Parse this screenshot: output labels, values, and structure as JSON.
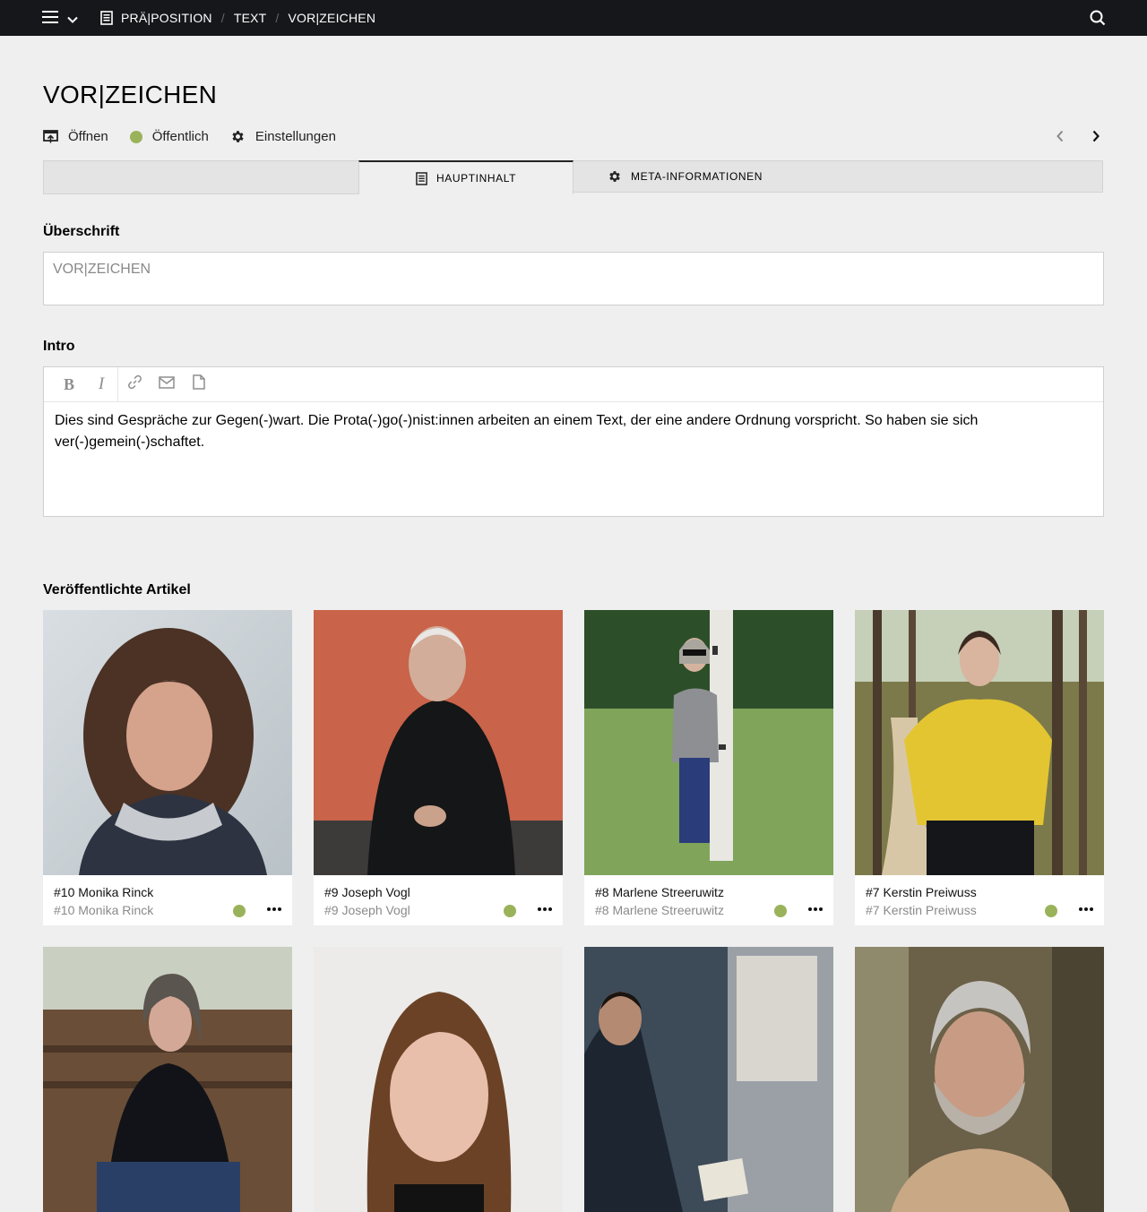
{
  "topbar": {
    "breadcrumbs": [
      {
        "label": "PRÄ|POSITION"
      },
      {
        "label": "TEXT"
      },
      {
        "label": "VOR|ZEICHEN"
      }
    ]
  },
  "page": {
    "title": "VOR|ZEICHEN",
    "actions": {
      "open": "Öffnen",
      "status": "Öffentlich",
      "settings": "Einstellungen"
    },
    "status_color": "#9ab35b"
  },
  "tabs": [
    {
      "label": "HAUPTINHALT",
      "icon": "document-icon",
      "active": true
    },
    {
      "label": "META-INFORMATIONEN",
      "icon": "gear-icon",
      "active": false
    }
  ],
  "fields": {
    "heading": {
      "label": "Überschrift",
      "placeholder": "VOR|ZEICHEN",
      "value": ""
    },
    "intro": {
      "label": "Intro",
      "toolbar": [
        "bold-icon",
        "italic-icon",
        "link-icon",
        "email-icon",
        "file-icon"
      ],
      "text": "Dies sind Gespräche zur Gegen(-)wart. Die Prota(-)go(-)nist:innen arbeiten an einem Text, der eine andere Ordnung vorspricht. So haben sie sich ver(-)gemein(-)schaftet."
    }
  },
  "published": {
    "label": "Veröffentlichte Artikel",
    "articles": [
      {
        "title": "#10 Monika Rinck",
        "subtitle": "#10 Monika Rinck"
      },
      {
        "title": "#9 Joseph Vogl",
        "subtitle": "#9 Joseph Vogl"
      },
      {
        "title": "#8 Marlene Streeruwitz",
        "subtitle": "#8 Marlene Streeruwitz"
      },
      {
        "title": "#7 Kerstin Preiwuss",
        "subtitle": "#7 Kerstin Preiwuss"
      },
      {
        "title": "",
        "subtitle": ""
      },
      {
        "title": "",
        "subtitle": ""
      },
      {
        "title": "",
        "subtitle": ""
      },
      {
        "title": "",
        "subtitle": ""
      }
    ]
  }
}
